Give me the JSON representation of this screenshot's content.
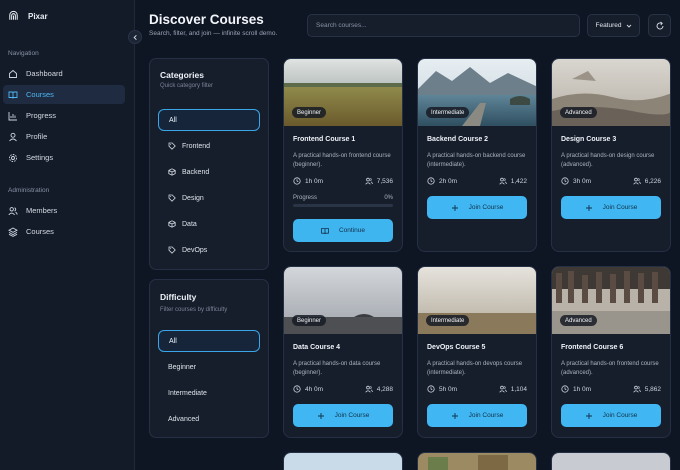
{
  "app": {
    "name": "Pixar"
  },
  "sidebar": {
    "sections": [
      {
        "label": "Navigation",
        "items": [
          {
            "label": "Dashboard",
            "icon": "home-icon",
            "active": false
          },
          {
            "label": "Courses",
            "icon": "book-icon",
            "active": true
          },
          {
            "label": "Progress",
            "icon": "chart-icon",
            "active": false
          },
          {
            "label": "Profile",
            "icon": "user-icon",
            "active": false
          },
          {
            "label": "Settings",
            "icon": "gear-icon",
            "active": false
          }
        ]
      },
      {
        "label": "Administration",
        "items": [
          {
            "label": "Members",
            "icon": "users-icon",
            "active": false
          },
          {
            "label": "Courses",
            "icon": "layers-icon",
            "active": false
          }
        ]
      }
    ]
  },
  "header": {
    "title": "Discover Courses",
    "subtitle": "Search, filter, and join — infinite scroll demo.",
    "search_placeholder": "Search courses...",
    "sort_value": "Featured"
  },
  "categories": {
    "title": "Categories",
    "subtitle": "Quick category filter",
    "items": [
      {
        "label": "All",
        "active": true,
        "icon": ""
      },
      {
        "label": "Frontend",
        "active": false,
        "icon": "tag-icon"
      },
      {
        "label": "Backend",
        "active": false,
        "icon": "cube-icon"
      },
      {
        "label": "Design",
        "active": false,
        "icon": "tag-icon"
      },
      {
        "label": "Data",
        "active": false,
        "icon": "cube-icon"
      },
      {
        "label": "DevOps",
        "active": false,
        "icon": "tag-icon"
      }
    ]
  },
  "difficulty": {
    "title": "Difficulty",
    "subtitle": "Filter courses by difficulty",
    "items": [
      {
        "label": "All",
        "active": true
      },
      {
        "label": "Beginner",
        "active": false
      },
      {
        "label": "Intermediate",
        "active": false
      },
      {
        "label": "Advanced",
        "active": false
      }
    ]
  },
  "courses": [
    {
      "title": "Frontend Course 1",
      "level": "Beginner",
      "description": "A practical hands-on frontend course (beginner).",
      "duration": "1h 0m",
      "learners": "7,536",
      "enrolled": true,
      "progress_label": "Progress",
      "progress_pct": "0%",
      "progress_fraction": 0,
      "action": "Continue",
      "theme": "field"
    },
    {
      "title": "Backend Course 2",
      "level": "Intermediate",
      "description": "A practical hands-on backend course (intermediate).",
      "duration": "2h 0m",
      "learners": "1,422",
      "enrolled": false,
      "action": "Join Course",
      "theme": "lake"
    },
    {
      "title": "Design Course 3",
      "level": "Advanced",
      "description": "A practical hands-on design course (advanced).",
      "duration": "3h 0m",
      "learners": "6,226",
      "enrolled": false,
      "action": "Join Course",
      "theme": "rocks"
    },
    {
      "title": "Data Course 4",
      "level": "Beginner",
      "description": "A practical hands-on data course (beginner).",
      "duration": "4h 0m",
      "learners": "4,288",
      "enrolled": false,
      "action": "Join Course",
      "theme": "pier"
    },
    {
      "title": "DevOps Course 5",
      "level": "Intermediate",
      "description": "A practical hands-on devops course (intermediate).",
      "duration": "5h 0m",
      "learners": "1,104",
      "enrolled": false,
      "action": "Join Course",
      "theme": "fog"
    },
    {
      "title": "Frontend Course 6",
      "level": "Advanced",
      "description": "A practical hands-on frontend course (advanced).",
      "duration": "1h 0m",
      "learners": "5,862",
      "enrolled": false,
      "action": "Join Course",
      "theme": "crowd"
    }
  ],
  "colors": {
    "accent": "#40b7f2",
    "background": "#0f1623",
    "panel": "#161e2c"
  }
}
